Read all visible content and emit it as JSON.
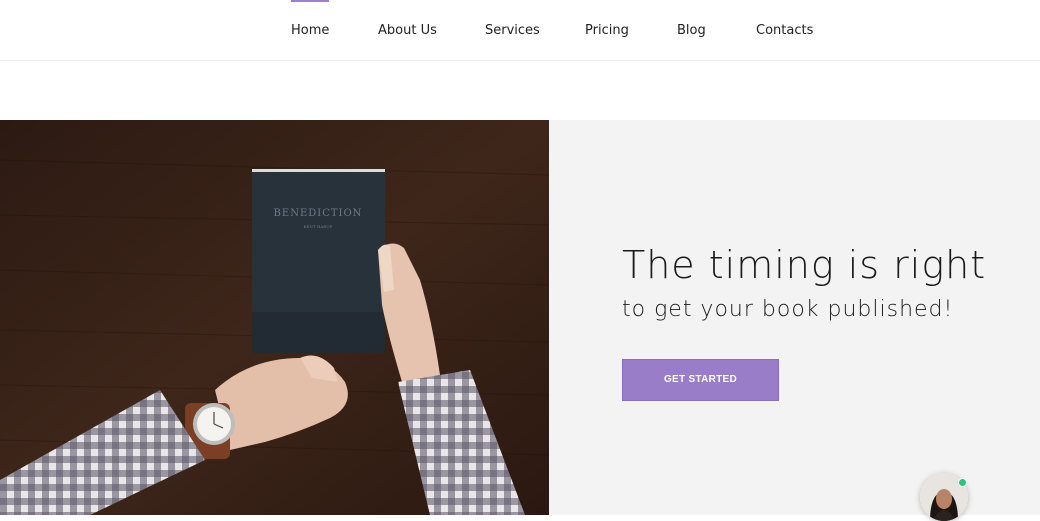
{
  "nav": {
    "items": [
      {
        "label": "Home",
        "active": true
      },
      {
        "label": "About Us"
      },
      {
        "label": "Services"
      },
      {
        "label": "Pricing"
      },
      {
        "label": "Blog"
      },
      {
        "label": "Contacts"
      }
    ]
  },
  "hero": {
    "photo": {
      "book_title": "BENEDICTION",
      "book_author": "KENT HARUF"
    },
    "title": "The timing is right",
    "subtitle": "to get your book published!",
    "cta_label": "GET STARTED"
  },
  "chat_widget": {
    "status": "online"
  },
  "colors": {
    "accent": "#9a7dc8",
    "panel_bg": "#f3f3f3",
    "online": "#2bc47a"
  }
}
